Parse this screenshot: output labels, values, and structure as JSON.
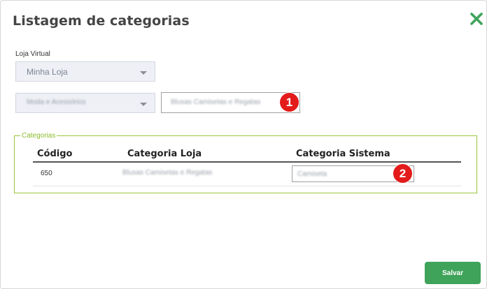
{
  "modal": {
    "title": "Listagem de categorias",
    "close_icon": "close-x-icon"
  },
  "form": {
    "loja_label": "Loja Virtual",
    "loja_value": "Minha Loja",
    "category_select_value": "Moda e Acessórios",
    "category_input_value": "Blusas Camisetas e Regatas"
  },
  "annotations": {
    "badge1": "1",
    "badge2": "2"
  },
  "categorias": {
    "legend": "Categorias",
    "columns": [
      "Código",
      "Categoria Loja",
      "Categoria Sistema"
    ],
    "rows": [
      {
        "codigo": "650",
        "categoria_loja": "Blusas Camisetas e Regatas",
        "categoria_sistema": "Camiseta"
      }
    ]
  },
  "footer": {
    "save_label": "Salvar"
  },
  "colors": {
    "accent_green": "#3fa35a",
    "fieldset_border": "#9ac63a",
    "badge_red": "#e31b1b"
  }
}
